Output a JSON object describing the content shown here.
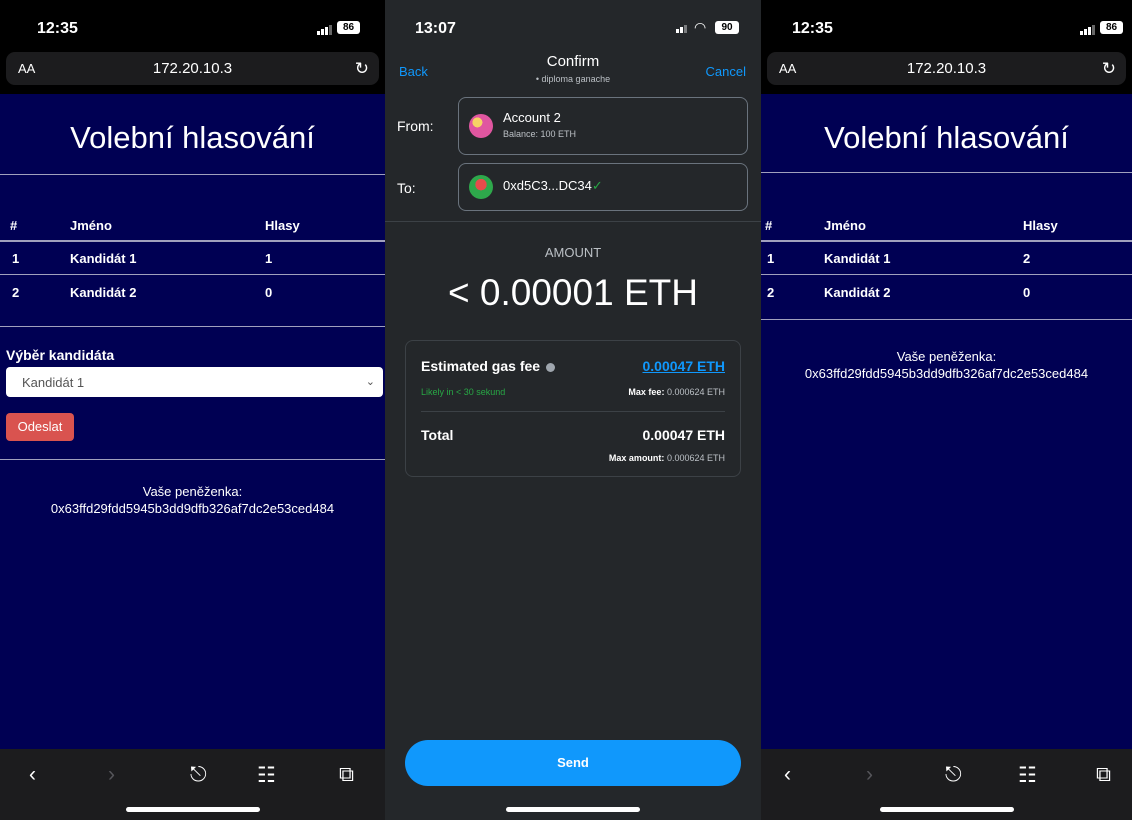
{
  "left_phone": {
    "status": {
      "time": "12:35",
      "battery": "86"
    },
    "browser": {
      "text_size": "AA",
      "url": "172.20.10.3",
      "reload": "↻"
    },
    "page": {
      "title": "Volební hlasování",
      "table": {
        "headers": [
          "#",
          "Jméno",
          "Hlasy"
        ],
        "rows": [
          [
            "1",
            "Kandidát 1",
            "1"
          ],
          [
            "2",
            "Kandidát 2",
            "0"
          ]
        ]
      },
      "select_label": "Výběr kandidáta",
      "select_value": "Kandidát 1",
      "submit_label": "Odeslat",
      "wallet_label": "Vaše peněženka:",
      "wallet_address": "0x63ffd29fdd5945b3dd9dfb326af7dc2e53ced484"
    },
    "toolbar_icons": [
      "back-icon",
      "forward-icon",
      "share-icon",
      "bookmarks-icon",
      "tabs-icon"
    ]
  },
  "middle_phone": {
    "status": {
      "time": "13:07",
      "battery": "90"
    },
    "nav": {
      "back": "Back",
      "title": "Confirm",
      "subtitle": "• diploma ganache",
      "cancel": "Cancel"
    },
    "from_label": "From:",
    "from_account": {
      "name": "Account 2",
      "balance": "Balance: 100 ETH"
    },
    "to_label": "To:",
    "to_address": "0xd5C3...DC34",
    "amount_label": "AMOUNT",
    "amount": "< 0.00001 ETH",
    "gas": {
      "title": "Estimated gas fee",
      "value": "0.00047 ETH",
      "likely": "Likely in < 30 sekund",
      "max_fee_label": "Max fee:",
      "max_fee_value": "0.000624 ETH",
      "total_label": "Total",
      "total_value": "0.00047 ETH",
      "max_amount_label": "Max amount:",
      "max_amount_value": "0.000624 ETH"
    },
    "send_label": "Send"
  },
  "right_phone": {
    "status": {
      "time": "12:35",
      "battery": "86"
    },
    "browser": {
      "text_size": "AA",
      "url": "172.20.10.3",
      "reload": "↻"
    },
    "page": {
      "title": "Volební hlasování",
      "table": {
        "headers": [
          "#",
          "Jméno",
          "Hlasy"
        ],
        "rows": [
          [
            "1",
            "Kandidát 1",
            "2"
          ],
          [
            "2",
            "Kandidát 2",
            "0"
          ]
        ]
      },
      "wallet_label": "Vaše peněženka:",
      "wallet_address": "0x63ffd29fdd5945b3dd9dfb326af7dc2e53ced484"
    }
  },
  "colors": {
    "page_bg": "#000053",
    "metamask_bg": "#24272a",
    "metamask_accent": "#1098fc",
    "submit_red": "#d9534f",
    "success_green": "#28a745"
  }
}
